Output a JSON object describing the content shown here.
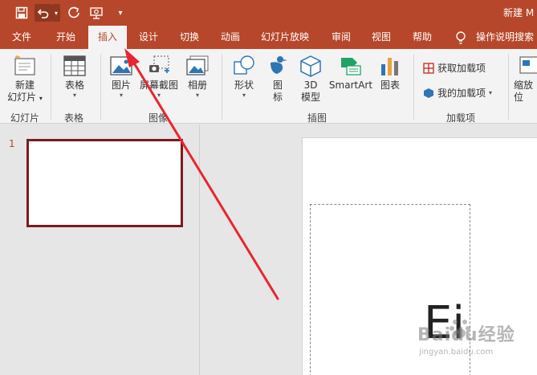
{
  "title_bar": {
    "doc_title": "新建 M",
    "icons": [
      "save-icon",
      "undo-icon",
      "undo-dropdown-icon",
      "redo-icon",
      "presentation-icon",
      "customize-qat-icon"
    ]
  },
  "tabs": {
    "file": "文件",
    "home": "开始",
    "insert": "插入",
    "design": "设计",
    "transitions": "切换",
    "animations": "动画",
    "slideshow": "幻灯片放映",
    "review": "审阅",
    "view": "视图",
    "help": "帮助",
    "tell_me": "操作说明搜索"
  },
  "ribbon": {
    "new_slide": [
      "新建",
      "幻灯片"
    ],
    "table": "表格",
    "picture": "图片",
    "screenshot": "屏幕截图",
    "album": "相册",
    "shapes": "形状",
    "icons": [
      "图",
      "标"
    ],
    "model3d": [
      "3D",
      "模型"
    ],
    "smartart": "SmartArt",
    "chart": "图表",
    "get_addins": "获取加载项",
    "my_addins": "我的加载项",
    "zoom": [
      "缩放",
      "位"
    ],
    "groups": {
      "slides": "幻灯片",
      "tables": "表格",
      "images": "图像",
      "illustrations": "插图",
      "addins": "加载项"
    }
  },
  "thumbnails": {
    "slide_number": "1"
  },
  "slide": {
    "glyph": "Ei"
  },
  "watermark": {
    "main": "Baidu经验",
    "sub": "jingyan.baidu.com"
  },
  "colors": {
    "accent": "#b7472a",
    "ribbon_bg": "#f3f3f3",
    "pane_bg": "#e6e6e6",
    "thumb_border": "#7c1a1f",
    "arrow": "#e8262f"
  }
}
